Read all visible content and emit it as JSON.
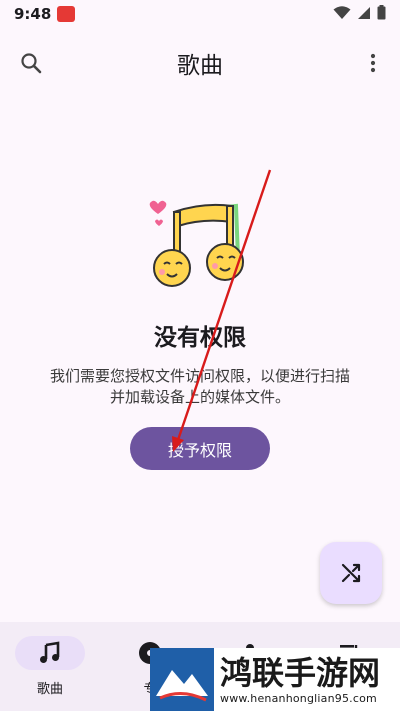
{
  "status_bar": {
    "time": "9:48",
    "app_icon": "app-notification-icon",
    "icons": [
      "wifi-icon",
      "signal-icon",
      "battery-icon"
    ]
  },
  "app_bar": {
    "title": "歌曲",
    "left_icon": "search-icon",
    "right_icon": "more-vert-icon"
  },
  "empty_state": {
    "illustration": "music-note-faces-icon",
    "title": "没有权限",
    "description": "我们需要您授权文件访问权限，以便进行扫描并加载设备上的媒体文件。",
    "button_label": "授予权限"
  },
  "fab": {
    "icon": "shuffle-icon"
  },
  "bottom_nav": {
    "items": [
      {
        "label": "歌曲",
        "icon": "music-note-icon",
        "active": true
      },
      {
        "label": "专",
        "icon": "album-icon",
        "active": false
      },
      {
        "label": "",
        "icon": "artist-icon",
        "active": false
      },
      {
        "label": "",
        "icon": "playlist-icon",
        "active": false
      }
    ]
  },
  "watermark": {
    "title": "鸿联手游网",
    "url": "www.henanhonglian95.com"
  },
  "colors": {
    "background": "#fdf7fd",
    "primary": "#6d549f",
    "fab_bg": "#eaddff",
    "nav_bg": "#f3ecf6",
    "nav_active": "#e9def8",
    "annotation_arrow": "#d81b1b"
  }
}
